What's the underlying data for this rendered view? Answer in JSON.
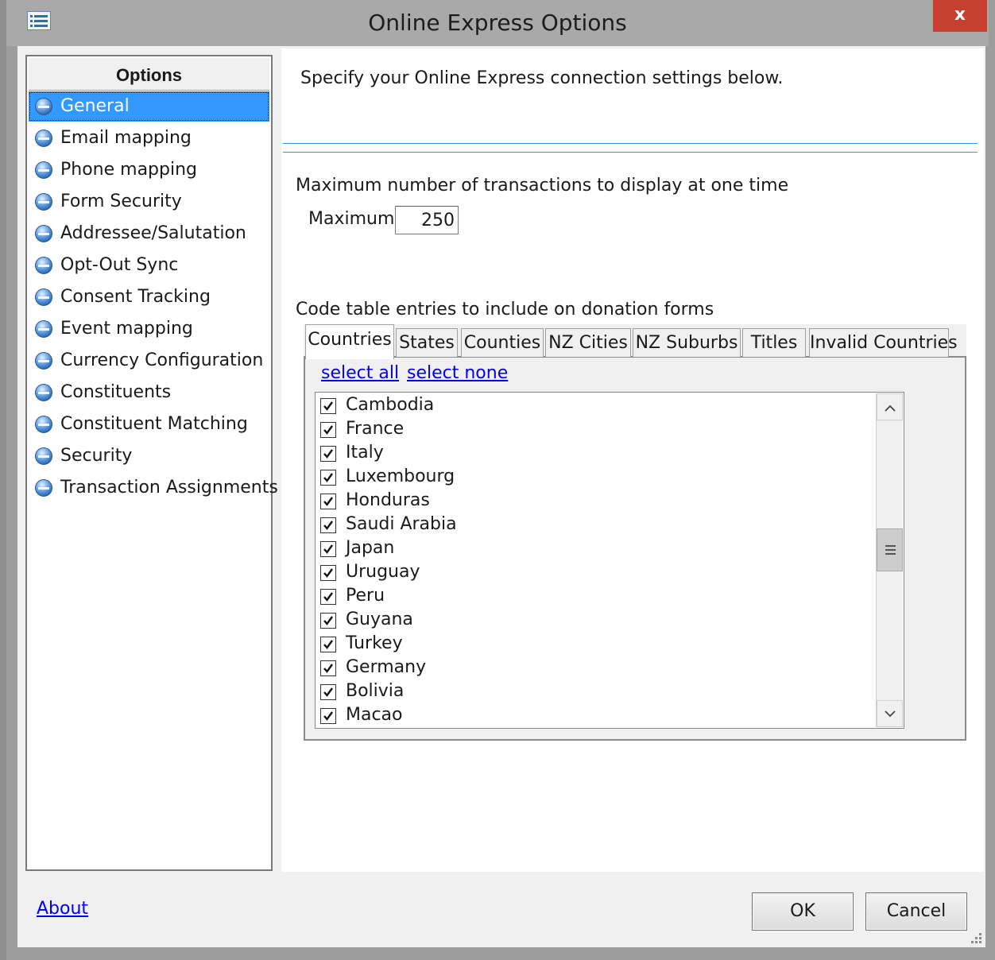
{
  "window": {
    "title": "Online Express Options",
    "close_label": "x"
  },
  "nav": {
    "header": "Options",
    "selected": "General",
    "items": [
      {
        "label": "General"
      },
      {
        "label": "Email mapping"
      },
      {
        "label": "Phone mapping"
      },
      {
        "label": "Form Security"
      },
      {
        "label": "Addressee/Salutation"
      },
      {
        "label": "Opt-Out Sync"
      },
      {
        "label": "Consent Tracking"
      },
      {
        "label": "Event mapping"
      },
      {
        "label": "Currency Configuration"
      },
      {
        "label": "Constituents"
      },
      {
        "label": "Constituent Matching"
      },
      {
        "label": "Security"
      },
      {
        "label": "Transaction Assignments"
      }
    ]
  },
  "main": {
    "intro": "Specify your Online Express connection settings below.",
    "transactions_label": "Maximum number of transactions to display at one time",
    "maximum_label": "Maximum:",
    "maximum_value": "250",
    "code_table_label": "Code table entries to include on donation forms",
    "tabs": [
      {
        "label": "Countries",
        "active": true
      },
      {
        "label": "States"
      },
      {
        "label": "Counties"
      },
      {
        "label": "NZ Cities"
      },
      {
        "label": "NZ Suburbs"
      },
      {
        "label": "Titles"
      },
      {
        "label": "Invalid Countries"
      }
    ],
    "select_all": "select all",
    "select_none": "select none",
    "countries": [
      {
        "name": "Cambodia",
        "checked": true
      },
      {
        "name": "France",
        "checked": true
      },
      {
        "name": "Italy",
        "checked": true
      },
      {
        "name": "Luxembourg",
        "checked": true
      },
      {
        "name": "Honduras",
        "checked": true
      },
      {
        "name": "Saudi Arabia",
        "checked": true
      },
      {
        "name": "Japan",
        "checked": true
      },
      {
        "name": "Uruguay",
        "checked": true
      },
      {
        "name": "Peru",
        "checked": true
      },
      {
        "name": "Guyana",
        "checked": true
      },
      {
        "name": "Turkey",
        "checked": true
      },
      {
        "name": "Germany",
        "checked": true
      },
      {
        "name": "Bolivia",
        "checked": true
      },
      {
        "name": "Macao",
        "checked": true
      }
    ]
  },
  "footer": {
    "about_label": "About",
    "ok_label": "OK",
    "cancel_label": "Cancel"
  },
  "colors": {
    "selection": "#3399ff",
    "separator": "#3d8ee6",
    "close_button": "#c7402f",
    "link": "#0000ee"
  }
}
